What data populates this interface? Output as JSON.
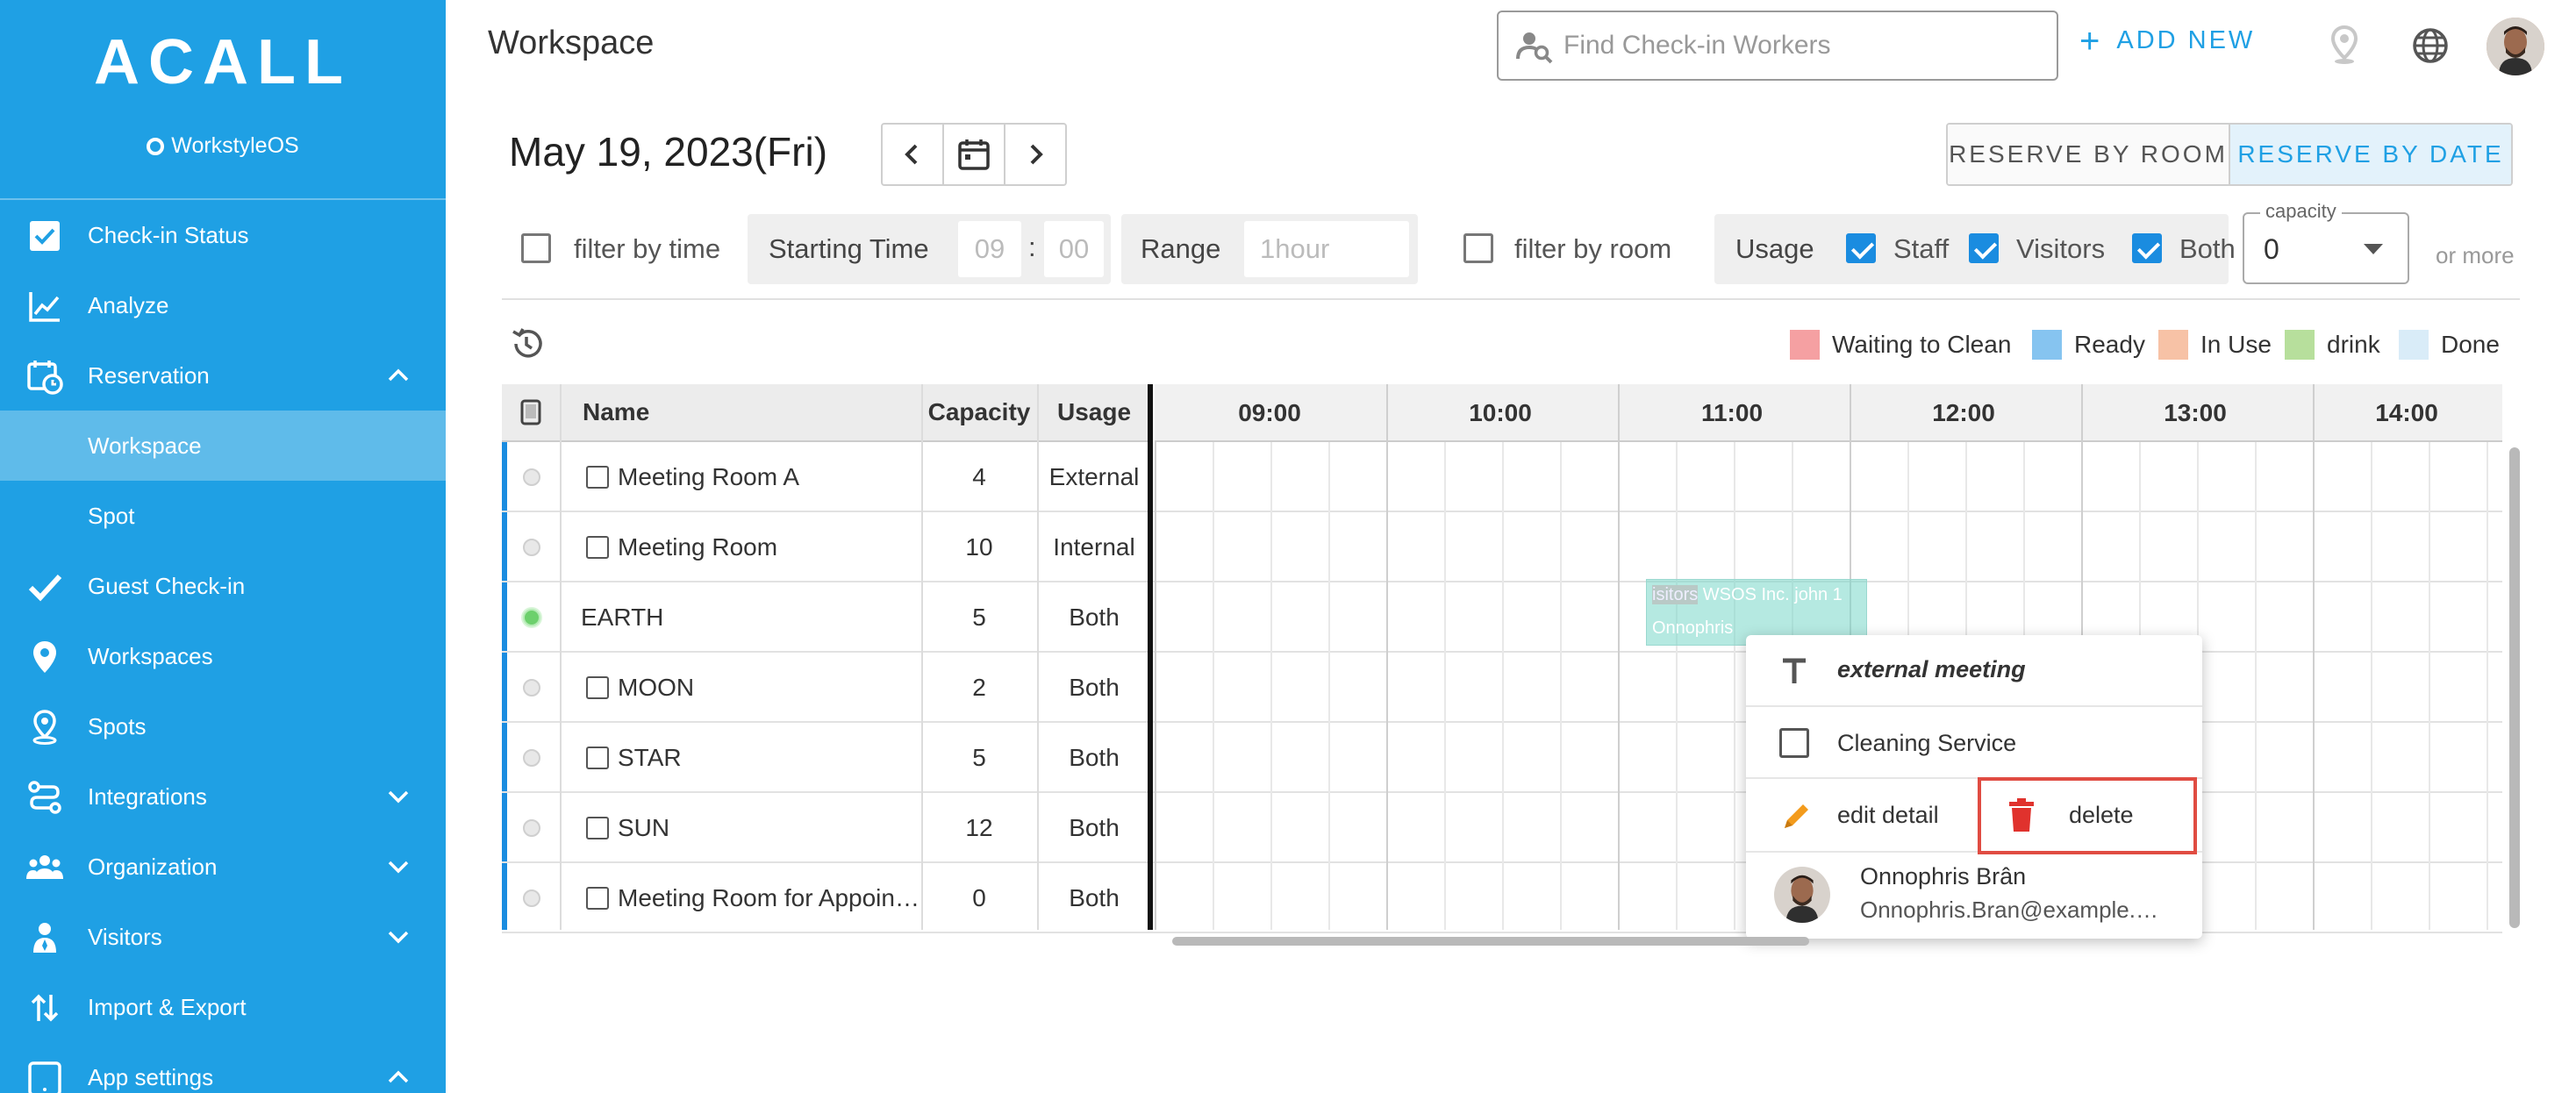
{
  "brand": {
    "logo": "ACALL",
    "sub": "WorkstyleOS"
  },
  "sidebar": {
    "items": [
      {
        "label": "Check-in Status",
        "icon": "checkbox-icon"
      },
      {
        "label": "Analyze",
        "icon": "line-chart-icon"
      },
      {
        "label": "Reservation",
        "icon": "calendar-clock-icon",
        "expanded": true
      },
      {
        "label": "Workspace",
        "active": true
      },
      {
        "label": "Spot"
      },
      {
        "label": "Guest Check-in",
        "icon": "check-icon"
      },
      {
        "label": "Workspaces",
        "icon": "location-pin-icon"
      },
      {
        "label": "Spots",
        "icon": "pin-outline-icon"
      },
      {
        "label": "Integrations",
        "icon": "integrations-icon",
        "expanded": false
      },
      {
        "label": "Organization",
        "icon": "people-icon",
        "expanded": false
      },
      {
        "label": "Visitors",
        "icon": "visitor-icon",
        "expanded": false
      },
      {
        "label": "Import & Export",
        "icon": "import-export-icon"
      },
      {
        "label": "App settings",
        "icon": "tablet-icon",
        "expanded": true
      }
    ]
  },
  "header": {
    "title": "Workspace",
    "search_placeholder": "Find Check-in Workers",
    "add_new": "ADD NEW"
  },
  "date_bar": {
    "date": "May 19, 2023(Fri)",
    "reserve_by_room": "RESERVE BY ROOM",
    "reserve_by_date": "RESERVE BY DATE",
    "selected_mode": "RESERVE BY DATE"
  },
  "filters": {
    "filter_by_time": "filter by time",
    "starting_time_label": "Starting Time",
    "hour": "09",
    "colon": ":",
    "minute": "00",
    "range_label": "Range",
    "range_value": "1hour",
    "filter_by_room": "filter by room",
    "usage_label": "Usage",
    "staff": "Staff",
    "visitors": "Visitors",
    "both": "Both",
    "capacity_label": "capacity",
    "capacity_value": "0",
    "or_more": "or more"
  },
  "legend": [
    {
      "label": "Waiting to Clean",
      "color": "#f5a0a2"
    },
    {
      "label": "Ready",
      "color": "#86c4f0"
    },
    {
      "label": "In Use",
      "color": "#f7c2a6"
    },
    {
      "label": "drink",
      "color": "#b7df9c"
    },
    {
      "label": "Done",
      "color": "#d9ecf8"
    }
  ],
  "table": {
    "headers": {
      "name": "Name",
      "capacity": "Capacity",
      "usage": "Usage"
    },
    "times": [
      "09:00",
      "10:00",
      "11:00",
      "12:00",
      "13:00",
      "14:00"
    ],
    "rows": [
      {
        "name": "Meeting Room A",
        "capacity": "4",
        "usage": "External",
        "checkbox": true,
        "status": "idle"
      },
      {
        "name": "Meeting Room",
        "capacity": "10",
        "usage": "Internal",
        "checkbox": true,
        "status": "idle"
      },
      {
        "name": "EARTH",
        "capacity": "5",
        "usage": "Both",
        "checkbox": false,
        "status": "active"
      },
      {
        "name": "MOON",
        "capacity": "2",
        "usage": "Both",
        "checkbox": true,
        "status": "idle"
      },
      {
        "name": "STAR",
        "capacity": "5",
        "usage": "Both",
        "checkbox": true,
        "status": "idle"
      },
      {
        "name": "SUN",
        "capacity": "12",
        "usage": "Both",
        "checkbox": true,
        "status": "idle"
      },
      {
        "name": "Meeting Room for Appoin…",
        "capacity": "0",
        "usage": "Both",
        "checkbox": true,
        "status": "idle"
      }
    ]
  },
  "booking": {
    "line1_tag": "isitors",
    "line1_text": "WSOS Inc. john 1",
    "line2": "Onnophris"
  },
  "context_menu": {
    "title": "external meeting",
    "cleaning": "Cleaning Service",
    "edit": "edit detail",
    "delete": "delete",
    "user_name": "Onnophris Brân",
    "user_email": "Onnophris.Bran@example.…"
  }
}
